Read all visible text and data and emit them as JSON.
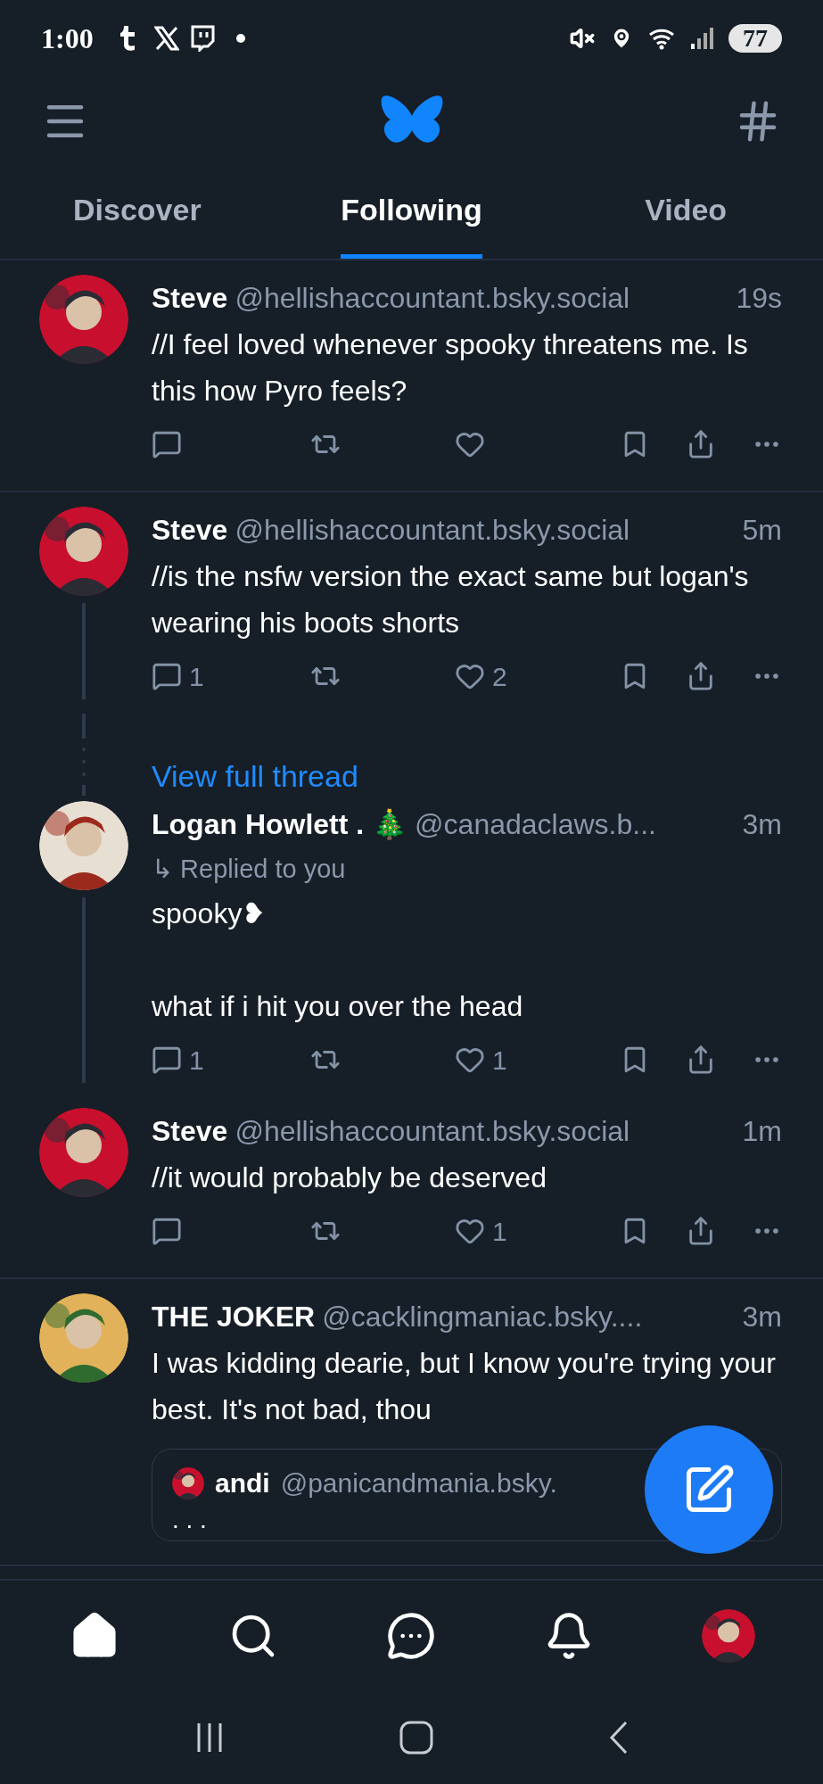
{
  "status_bar": {
    "time": "1:00",
    "battery": "77"
  },
  "tabs": [
    {
      "label": "Discover",
      "selected": false
    },
    {
      "label": "Following",
      "selected": true
    },
    {
      "label": "Video",
      "selected": false
    }
  ],
  "feed": [
    {
      "items": [
        {
          "kind": "post",
          "name": "Steve",
          "handle": "@hellishaccountant.bsky.social",
          "time": "19s",
          "text": "//I feel loved whenever spooky threatens me. Is this how Pyro feels?"
        }
      ]
    },
    {
      "items": [
        {
          "kind": "post",
          "name": "Steve",
          "handle": "@hellishaccountant.bsky.social",
          "time": "5m",
          "text": "//is the nsfw version the exact same but logan's wearing his boots shorts",
          "replies": "1",
          "likes": "2"
        },
        {
          "kind": "view_thread",
          "label": "View full thread"
        },
        {
          "kind": "post",
          "name": "Logan Howlett . 🎄",
          "handle": "@canadaclaws.b...",
          "time": "3m",
          "reply_note": "↳ Replied to you",
          "text": "spooky❥\n\nwhat if i hit you over the head",
          "replies": "1",
          "likes": "1"
        },
        {
          "kind": "post",
          "name": "Steve",
          "handle": "@hellishaccountant.bsky.social",
          "time": "1m",
          "text": "//it would probably be deserved",
          "likes": "1"
        }
      ]
    },
    {
      "items": [
        {
          "kind": "post",
          "name": "THE JOKER",
          "handle": "@cacklingmaniac.bsky....",
          "time": "3m",
          "text": "I was kidding dearie, but I know you're trying your best. It's not bad, thou",
          "quote": {
            "name": "andi",
            "handle": "@panicandmania.bsky.",
            "text": ". . ."
          }
        }
      ]
    }
  ],
  "bottom_nav": [
    {
      "kind": "home",
      "selected": true
    },
    {
      "kind": "search",
      "selected": false
    },
    {
      "kind": "chat",
      "selected": false
    },
    {
      "kind": "notifications",
      "selected": false
    },
    {
      "kind": "profile",
      "selected": false
    }
  ]
}
